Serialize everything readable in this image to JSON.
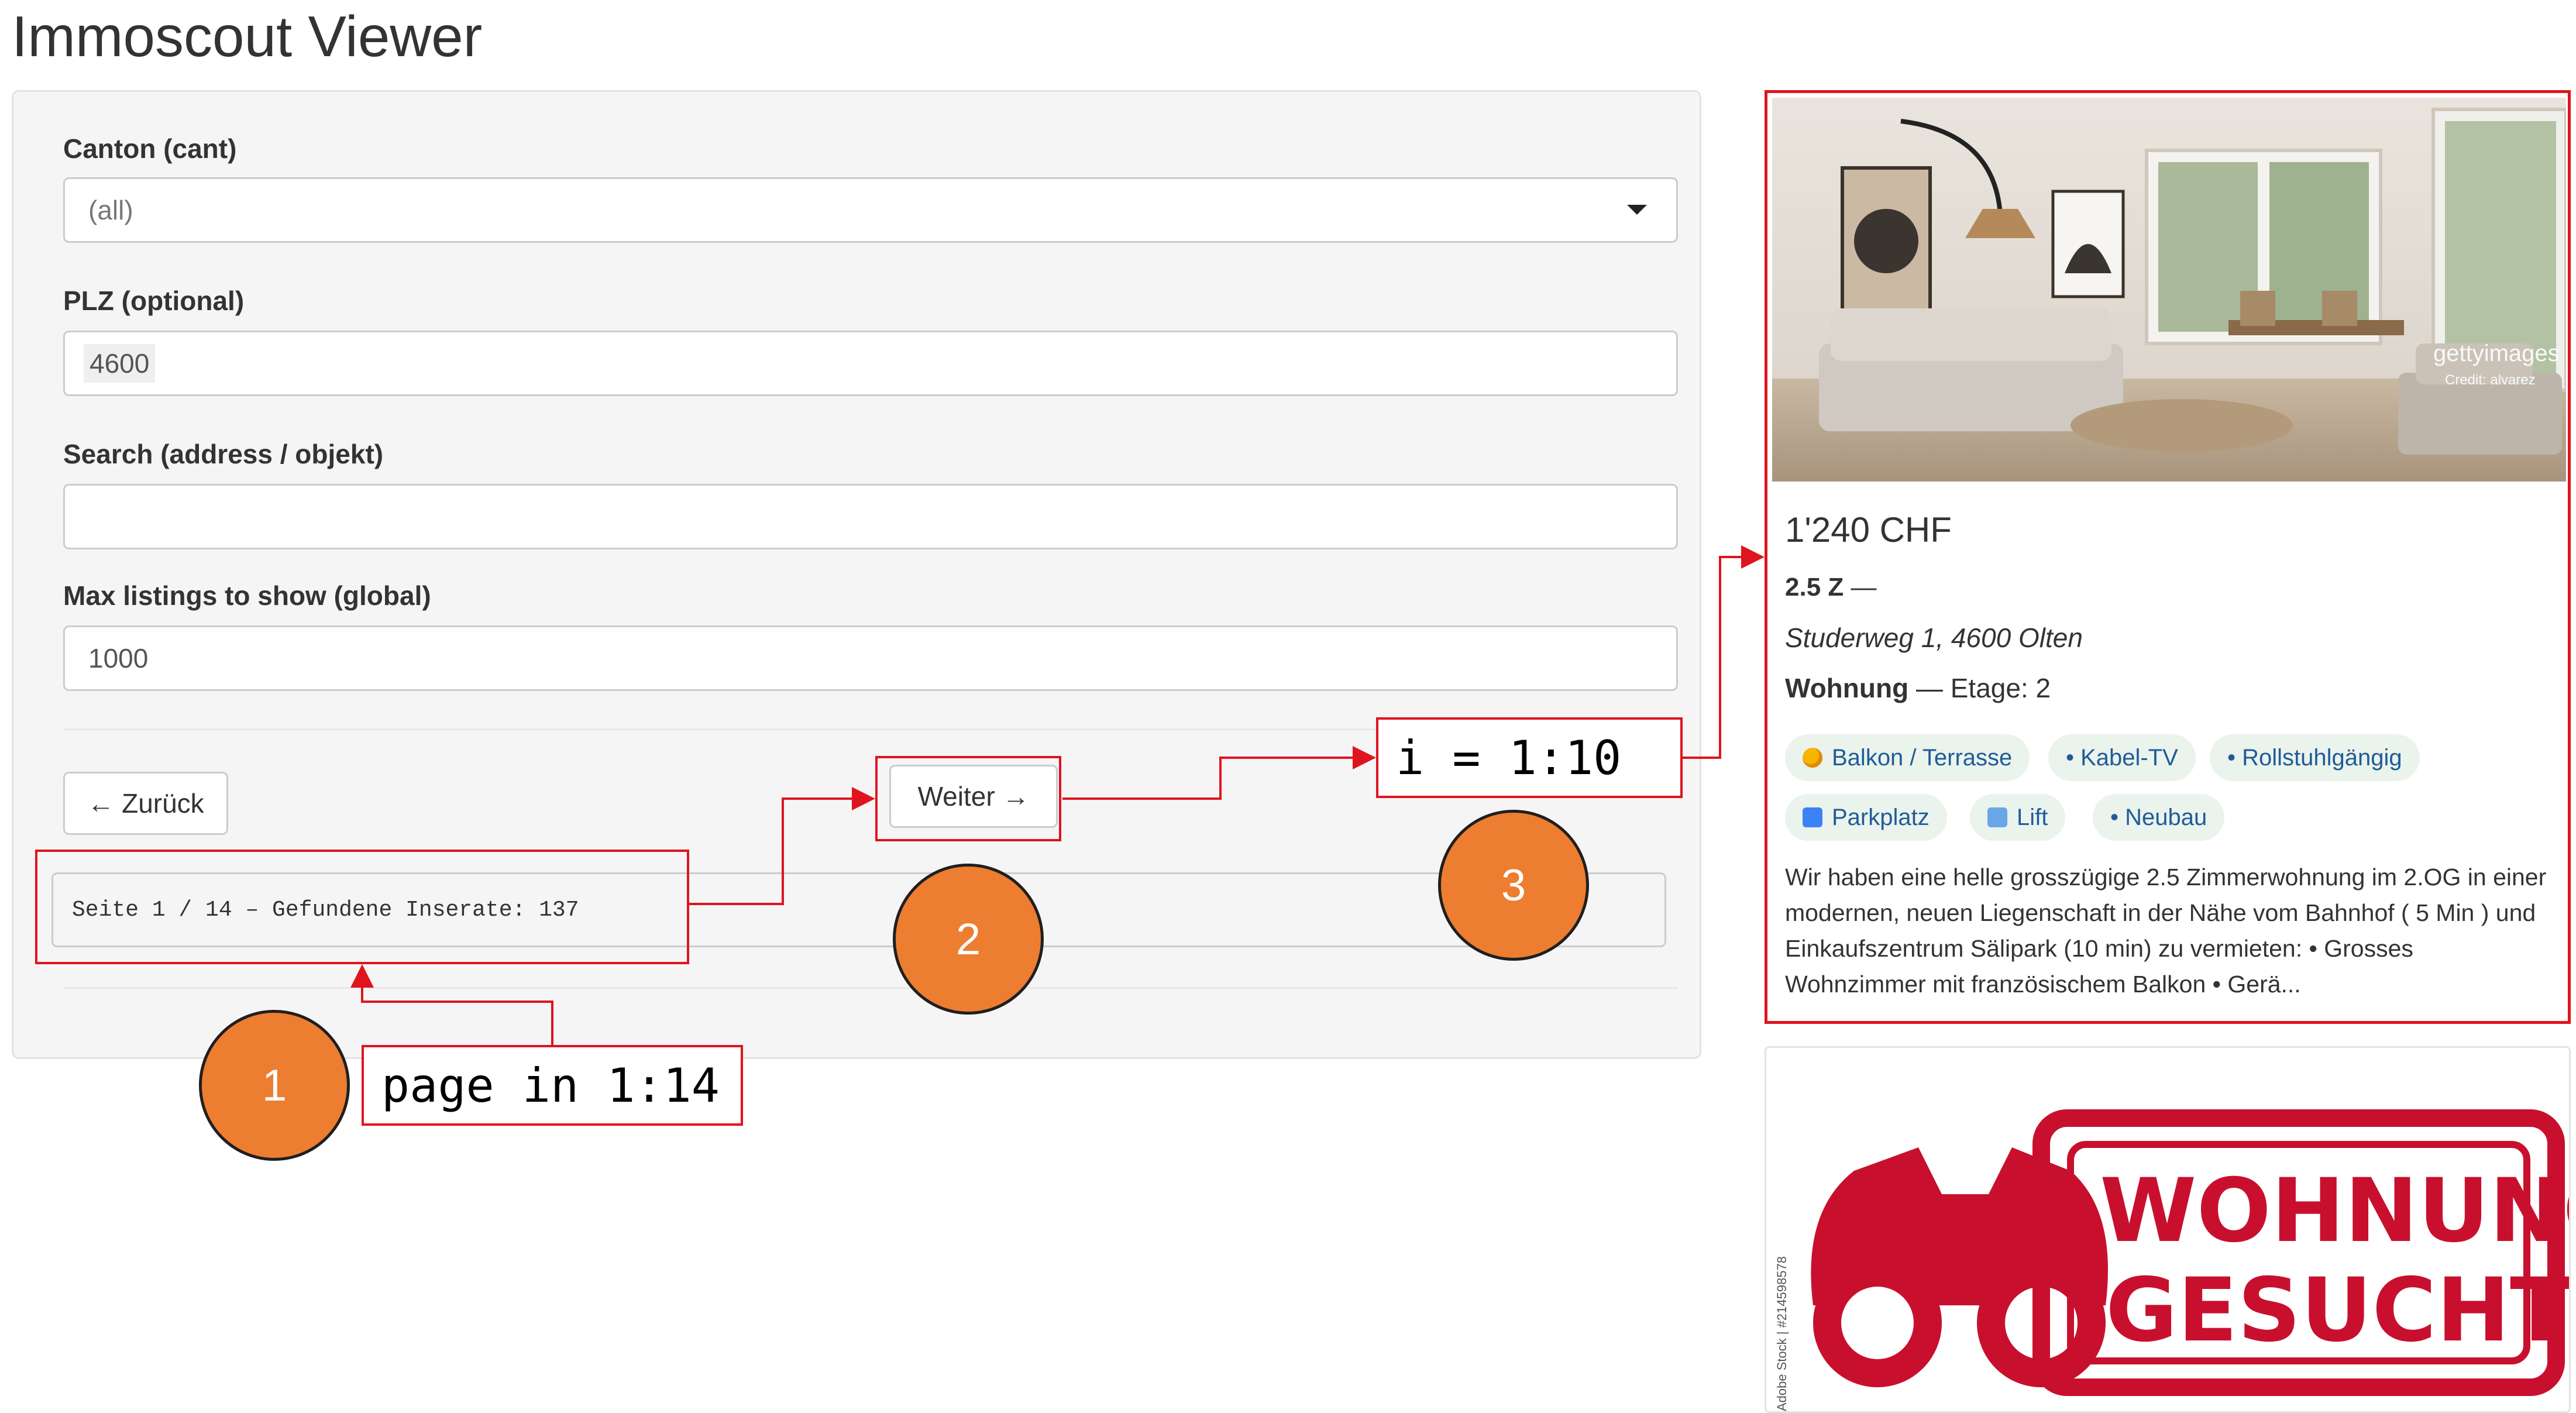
{
  "app": {
    "title": "Immoscout Viewer"
  },
  "filters": {
    "canton_label": "Canton (cant)",
    "canton_value": "(all)",
    "plz_label": "PLZ (optional)",
    "plz_value": "4600",
    "search_label": "Search (address / objekt)",
    "search_value": "",
    "max_label": "Max listings to show (global)",
    "max_value": "1000"
  },
  "nav": {
    "back_label": "← Zurück",
    "next_label": "Weiter →"
  },
  "pager": {
    "text": "Seite 1 / 14 – Gefundene Inserate: 137"
  },
  "annotations": {
    "page_loop": "page in 1:14",
    "item_loop": "i = 1:10",
    "step1": "1",
    "step2": "2",
    "step3": "3"
  },
  "listing": {
    "photo_watermark": "gettyimages",
    "photo_credit": "Credit: alvarez",
    "price": "1'240 CHF",
    "rooms": "2.5 Z",
    "rooms_suffix": " —",
    "address": "Studerweg 1, 4600 Olten",
    "type": "Wohnung",
    "floor": " — Etage: 2",
    "features": [
      {
        "label": "Balkon / Terrasse",
        "icon": "sun-icon"
      },
      {
        "label": "• Kabel-TV",
        "icon": ""
      },
      {
        "label": "• Rollstuhlgängig",
        "icon": ""
      },
      {
        "label": "Parkplatz",
        "icon": "parking-icon"
      },
      {
        "label": "Lift",
        "icon": "elevator-icon"
      },
      {
        "label": "• Neubau",
        "icon": ""
      }
    ],
    "description": "Wir haben eine helle grosszügige 2.5 Zimmerwohnung im 2.OG in einer modernen, neuen Liegenschaft in der Nähe vom Bahnhof ( 5 Min ) und Einkaufszentrum Sälipark (10 min) zu vermieten: • Grosses Wohnzimmer mit französischem Balkon • Gerä..."
  },
  "listing2": {
    "stamp_line1": "WOHNUNG",
    "stamp_line2": "GESUCHT!",
    "side_credit": "Adobe Stock | #214598578"
  },
  "colors": {
    "accent_red": "#e0141e",
    "step_orange": "#ed7d31",
    "chip_bg": "#eaf3ec"
  }
}
